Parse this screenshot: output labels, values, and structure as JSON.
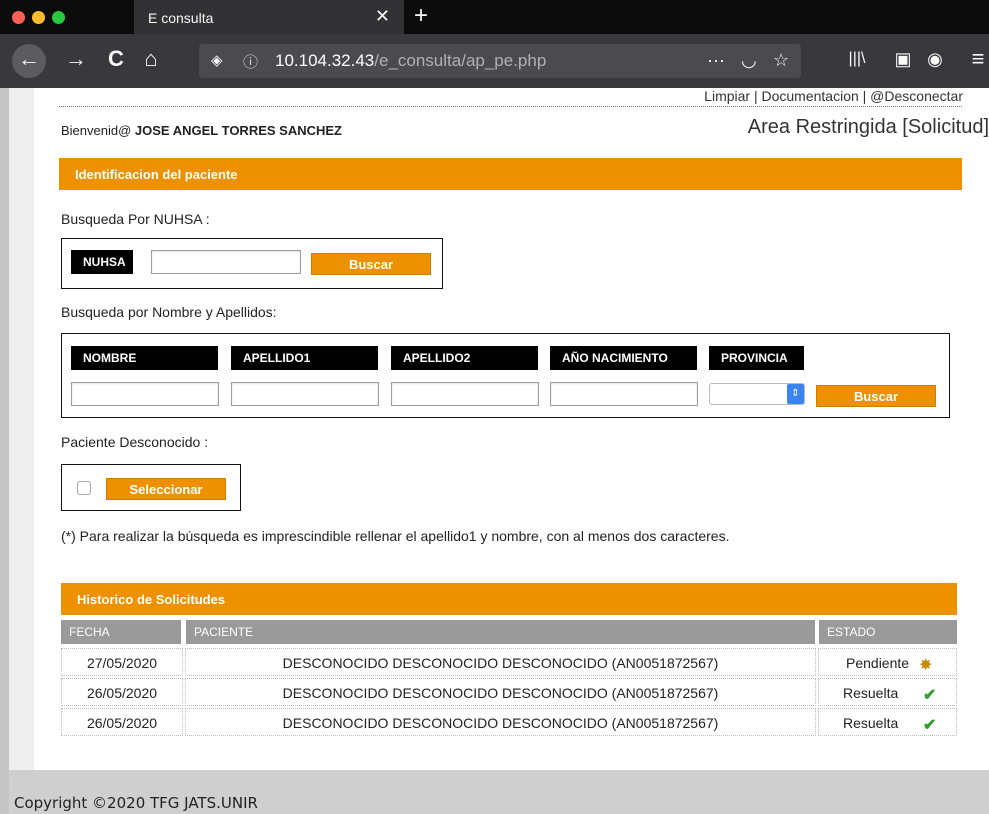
{
  "browser": {
    "tab_title": "E consulta",
    "tab_close": "✕",
    "new_tab": "+",
    "url_host": "10.104.32.43",
    "url_path": "/e_consulta/ap_pe.php",
    "back": "←",
    "forward": "→",
    "reload": "C",
    "home": "⌂",
    "shield": "◈",
    "info": "ⓘ",
    "more": "···",
    "pocket": "◡",
    "star": "☆",
    "library": "|||\\",
    "sidebar": "▣",
    "account": "◉",
    "menu": "≡"
  },
  "header": {
    "toplinks": "Limpiar | Documentacion | @Desconectar",
    "welcome_prefix": "Bienvenid@",
    "user_name": "JOSE ANGEL TORRES SANCHEZ",
    "area": "Area Restringida [Solicitud]"
  },
  "identificacion": {
    "section_title": "Identificacion del paciente",
    "nuhsa_label": "Busqueda Por NUHSA :",
    "nuhsa_tag": "NUHSA",
    "nuhsa_value": "",
    "nuhsa_button": "Buscar",
    "nombre_label": "Busqueda por Nombre y Apellidos:",
    "columns": [
      "NOMBRE",
      "APELLIDO1",
      "APELLIDO2",
      "AÑO NACIMIENTO",
      "PROVINCIA"
    ],
    "nombre_value": "",
    "apellido1_value": "",
    "apellido2_value": "",
    "anio_value": "",
    "provincia_value": "",
    "nombre_button": "Buscar",
    "desconocido_label": "Paciente Desconocido :",
    "desconocido_button": "Seleccionar",
    "note": "(*) Para realizar la búsqueda es imprescindible rellenar el apellido1 y nombre, con al menos dos caracteres."
  },
  "historico": {
    "section_title": "Historico de Solicitudes",
    "headers": {
      "fecha": "FECHA",
      "paciente": "PACIENTE",
      "estado": "ESTADO"
    },
    "rows": [
      {
        "fecha": "27/05/2020",
        "paciente": "DESCONOCIDO DESCONOCIDO DESCONOCIDO (AN0051872567)",
        "estado": "Pendiente",
        "icon": "pending-icon"
      },
      {
        "fecha": "26/05/2020",
        "paciente": "DESCONOCIDO DESCONOCIDO DESCONOCIDO (AN0051872567)",
        "estado": "Resuelta",
        "icon": "resolved-check-icon"
      },
      {
        "fecha": "26/05/2020",
        "paciente": "DESCONOCIDO DESCONOCIDO DESCONOCIDO (AN0051872567)",
        "estado": "Resuelta",
        "icon": "resolved-check-icon"
      }
    ]
  },
  "footer": {
    "copyright": "Copyright ©2020 TFG JATS.UNIR"
  },
  "colors": {
    "accent": "#ee9100",
    "black_tag": "#000000",
    "table_header": "#9a9a9a",
    "select_arrow": "#3a84ef"
  }
}
